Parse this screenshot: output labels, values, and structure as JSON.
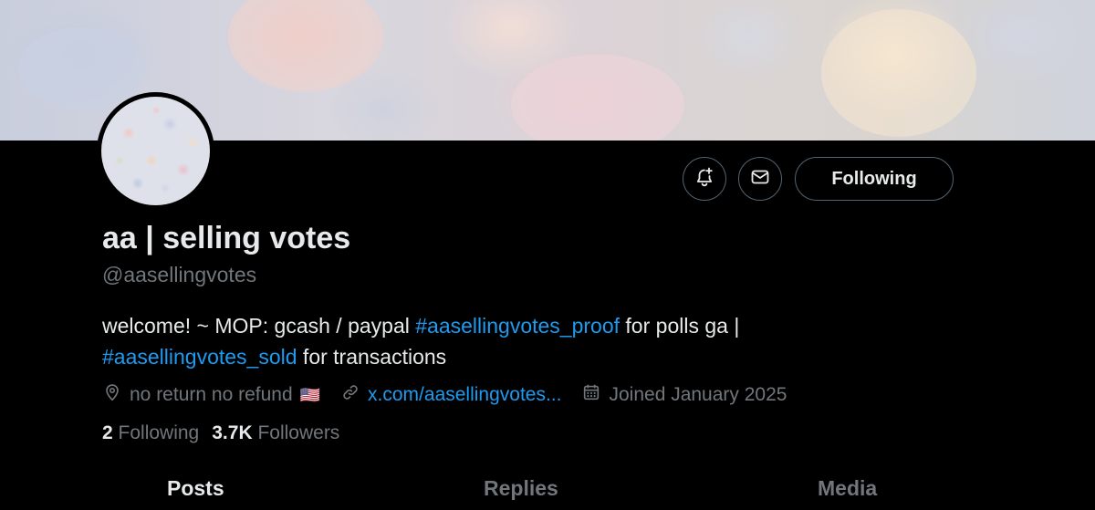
{
  "profile": {
    "display_name": "aa | selling votes",
    "handle": "@aasellingvotes",
    "bio": {
      "text_1": "welcome! ~ MOP: gcash / paypal ",
      "tag_1": "#aasellingvotes_proof",
      "text_2": " for polls ga | ",
      "tag_2": "#aasellingvotes_sold",
      "text_3": " for transactions"
    },
    "location": "no return no refund",
    "location_flag": "🇺🇸",
    "website": "x.com/aasellingvotes...",
    "joined": "Joined January 2025"
  },
  "stats": {
    "following_count": "2",
    "following_label": "Following",
    "followers_count": "3.7K",
    "followers_label": "Followers"
  },
  "actions": {
    "notify_icon": "bell-plus-icon",
    "message_icon": "envelope-icon",
    "follow_state_label": "Following"
  },
  "tabs": [
    {
      "label": "Posts",
      "active": true
    },
    {
      "label": "Replies",
      "active": false
    },
    {
      "label": "Media",
      "active": false
    }
  ],
  "colors": {
    "background": "#000000",
    "text_primary": "#e7e9ea",
    "text_secondary": "#71767b",
    "accent_link": "#1d9bf0",
    "border": "#536471"
  }
}
